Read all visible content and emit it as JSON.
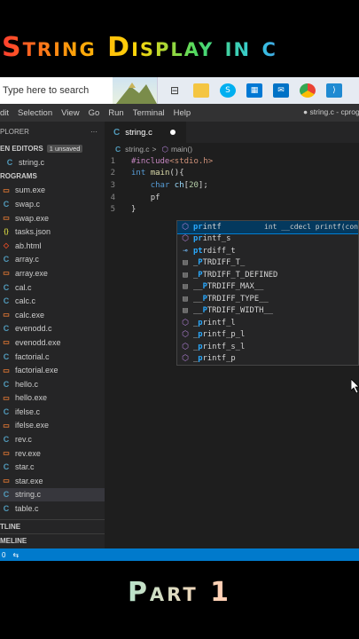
{
  "overlay": {
    "title": "String Display in c",
    "subtitle": "Part 1"
  },
  "taskbar": {
    "search_placeholder": "Type here to search",
    "icons": [
      "task-view-icon",
      "file-explorer-icon",
      "skype-icon",
      "store-icon",
      "mail-icon",
      "chrome-icon",
      "vscode-icon"
    ]
  },
  "menubar": {
    "items": [
      "dit",
      "Selection",
      "View",
      "Go",
      "Run",
      "Terminal",
      "Help"
    ],
    "window_title": "● string.c - cprog"
  },
  "sidebar": {
    "header": "PLORER",
    "header_more": "···",
    "open_editors_label": "EN EDITORS",
    "unsaved_badge": "1 unsaved",
    "open_file": "string.c",
    "folder_label": "ROGRAMS",
    "files": [
      {
        "name": "sum.exe",
        "type": "exe"
      },
      {
        "name": "swap.c",
        "type": "c"
      },
      {
        "name": "swap.exe",
        "type": "exe"
      },
      {
        "name": "tasks.json",
        "type": "json"
      },
      {
        "name": "ab.html",
        "type": "html"
      },
      {
        "name": "array.c",
        "type": "c"
      },
      {
        "name": "array.exe",
        "type": "exe"
      },
      {
        "name": "cal.c",
        "type": "c"
      },
      {
        "name": "calc.c",
        "type": "c"
      },
      {
        "name": "calc.exe",
        "type": "exe"
      },
      {
        "name": "evenodd.c",
        "type": "c"
      },
      {
        "name": "evenodd.exe",
        "type": "exe"
      },
      {
        "name": "factorial.c",
        "type": "c"
      },
      {
        "name": "factorial.exe",
        "type": "exe"
      },
      {
        "name": "hello.c",
        "type": "c"
      },
      {
        "name": "hello.exe",
        "type": "exe"
      },
      {
        "name": "ifelse.c",
        "type": "c"
      },
      {
        "name": "ifelse.exe",
        "type": "exe"
      },
      {
        "name": "rev.c",
        "type": "c"
      },
      {
        "name": "rev.exe",
        "type": "exe"
      },
      {
        "name": "star.c",
        "type": "c"
      },
      {
        "name": "star.exe",
        "type": "exe"
      },
      {
        "name": "string.c",
        "type": "c",
        "selected": true
      },
      {
        "name": "table.c",
        "type": "c"
      }
    ],
    "outline_label": "TLINE",
    "timeline_label": "MELINE"
  },
  "editor": {
    "tab_label": "string.c",
    "breadcrumb_file": "string.c",
    "breadcrumb_sep": ">",
    "breadcrumb_symbol": "main()",
    "lines": [
      {
        "n": "1",
        "tokens": [
          [
            "kw-pp",
            "#include"
          ],
          [
            "str",
            "<stdio.h>"
          ]
        ]
      },
      {
        "n": "2",
        "tokens": [
          [
            "kw",
            "int"
          ],
          [
            "cd",
            " "
          ],
          [
            "fn",
            "main"
          ],
          [
            "cd",
            "(){"
          ]
        ]
      },
      {
        "n": "3",
        "tokens": [
          [
            "cd",
            "    "
          ],
          [
            "kw",
            "char"
          ],
          [
            "cd",
            " "
          ],
          [
            "var",
            "ch"
          ],
          [
            "cd",
            "["
          ],
          [
            "num",
            "20"
          ],
          [
            "cd",
            "];"
          ]
        ]
      },
      {
        "n": "4",
        "tokens": [
          [
            "cd",
            "    "
          ],
          [
            "cd",
            "pf"
          ]
        ]
      },
      {
        "n": "5",
        "tokens": [
          [
            "cd",
            "}"
          ]
        ]
      }
    ]
  },
  "suggestions": [
    {
      "icon": "m",
      "match": "pr",
      "rest": "intf",
      "pre": "",
      "detail": "int __cdecl printf(const",
      "active": true
    },
    {
      "icon": "m",
      "match": "pr",
      "rest": "intf_s",
      "pre": "",
      "detail": ""
    },
    {
      "icon": "f",
      "match": "pt",
      "rest": "rdiff_t",
      "pre": "",
      "detail": ""
    },
    {
      "icon": "k",
      "match": "P",
      "rest": "TRDIFF_T_",
      "pre": "_",
      "detail": ""
    },
    {
      "icon": "k",
      "match": "P",
      "rest": "TRDIFF_T_DEFINED",
      "pre": "_",
      "detail": ""
    },
    {
      "icon": "k",
      "match": "P",
      "rest": "TRDIFF_MAX__",
      "pre": "__",
      "detail": ""
    },
    {
      "icon": "k",
      "match": "P",
      "rest": "TRDIFF_TYPE__",
      "pre": "__",
      "detail": ""
    },
    {
      "icon": "k",
      "match": "P",
      "rest": "TRDIFF_WIDTH__",
      "pre": "__",
      "detail": ""
    },
    {
      "icon": "m",
      "match": "p",
      "rest": "rintf_l",
      "pre": "_",
      "detail": ""
    },
    {
      "icon": "m",
      "match": "p",
      "rest": "rintf_p_l",
      "pre": "_",
      "detail": ""
    },
    {
      "icon": "m",
      "match": "p",
      "rest": "rintf_s_l",
      "pre": "_",
      "detail": ""
    },
    {
      "icon": "m",
      "match": "p",
      "rest": "rintf_p",
      "pre": "_",
      "detail": ""
    }
  ],
  "statusbar": {
    "errors": "0",
    "remote_icon": "live-share-icon"
  },
  "colors": {
    "accent": "#007acc",
    "editor_bg": "#1e1e1e",
    "sidebar_bg": "#252526"
  }
}
